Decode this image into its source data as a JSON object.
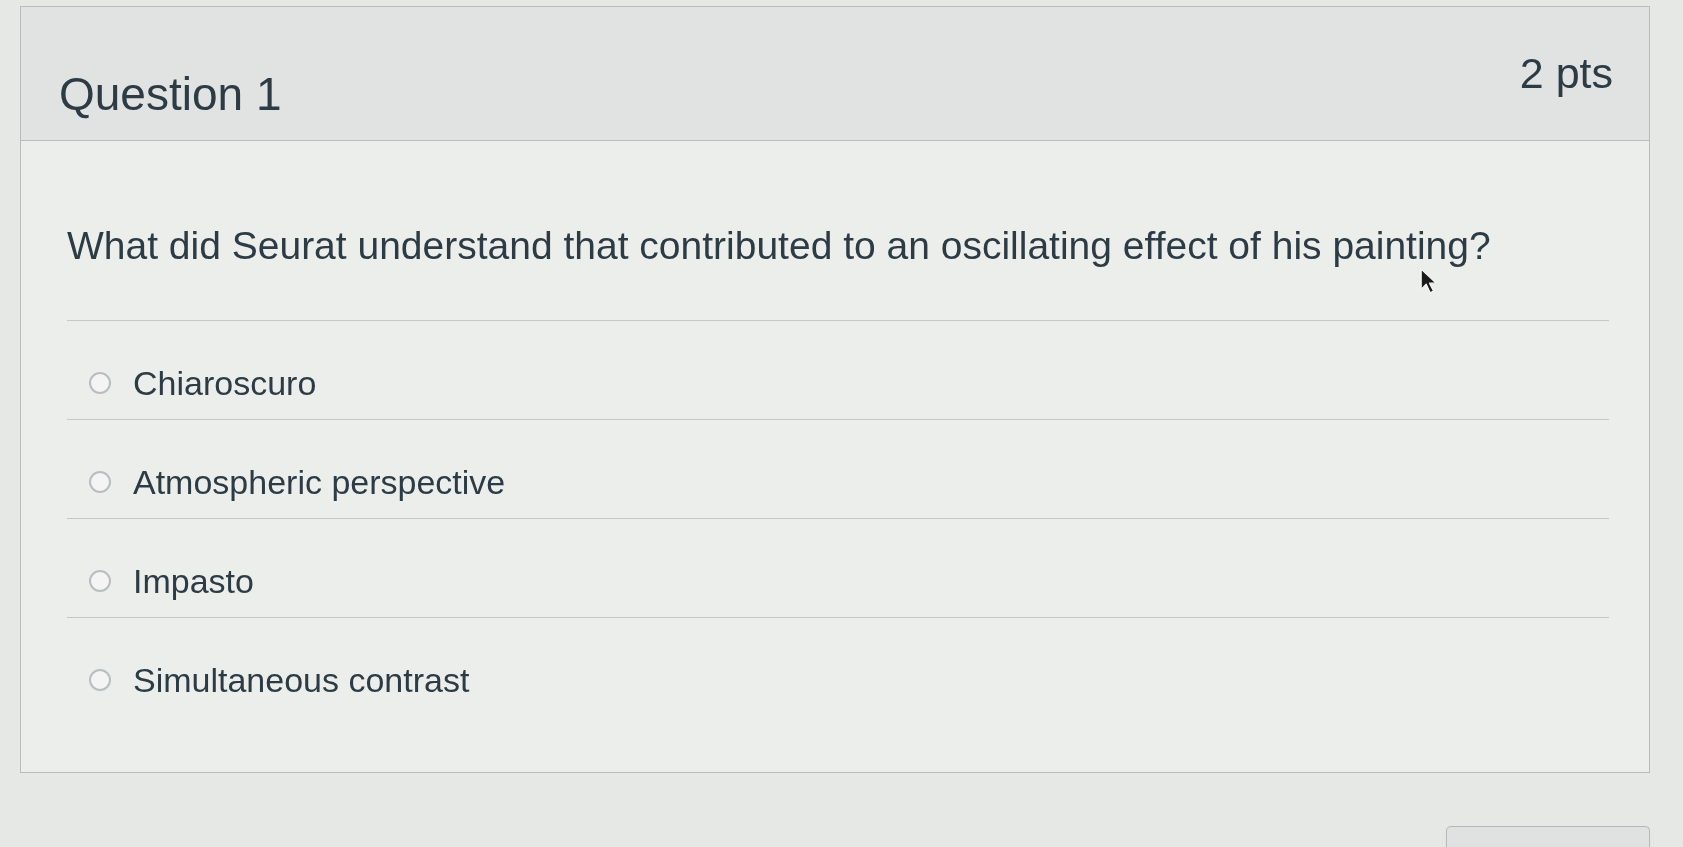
{
  "question": {
    "title": "Question 1",
    "points": "2 pts",
    "text": "What did Seurat understand that contributed to an oscillating effect of his painting?",
    "answers": [
      {
        "label": "Chiaroscuro",
        "selected": false
      },
      {
        "label": "Atmospheric perspective",
        "selected": false
      },
      {
        "label": "Impasto",
        "selected": false
      },
      {
        "label": "Simultaneous contrast",
        "selected": false
      }
    ]
  }
}
